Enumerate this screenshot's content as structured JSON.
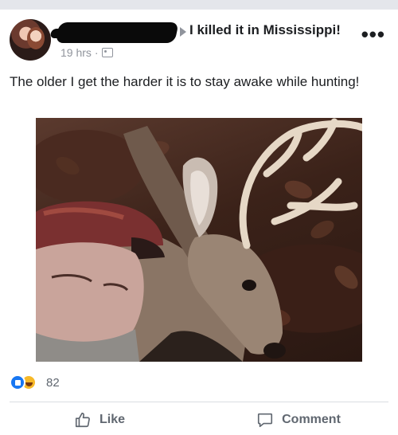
{
  "post": {
    "feeling_text": "I killed it in Mississippi!",
    "timestamp": "19 hrs",
    "separator": "·",
    "body": "The older I get the harder it is to stay awake while hunting!",
    "reaction_count": "82"
  },
  "actions": {
    "like_label": "Like",
    "comment_label": "Comment"
  },
  "icons": {
    "more": "more-icon",
    "audience": "audience-icon",
    "like": "thumbs-up-icon",
    "comment": "comment-icon",
    "reactions": [
      "like-reaction-icon",
      "haha-reaction-icon"
    ]
  },
  "colors": {
    "text": "#1c1e21",
    "muted": "#90949c",
    "action": "#606770",
    "like_blue": "#1877f2",
    "haha_yellow": "#f7b928",
    "divider": "#dadde1"
  }
}
